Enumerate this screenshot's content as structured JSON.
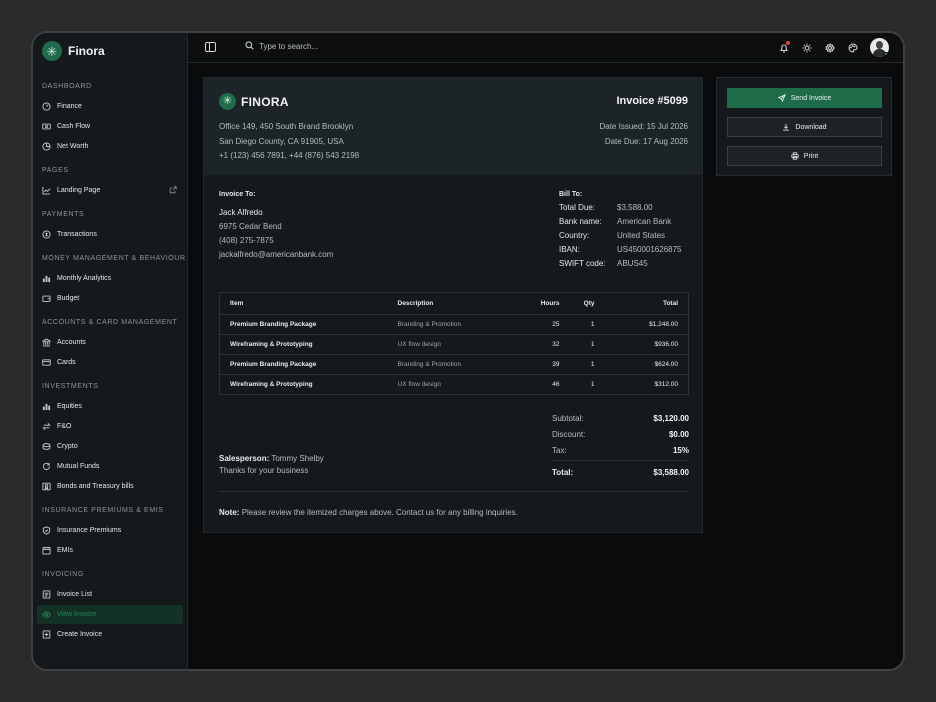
{
  "app": {
    "name": "Finora"
  },
  "sidebar": {
    "sections": [
      {
        "title": "DASHBOARD",
        "items": [
          {
            "label": "Finance",
            "icon": "gauge-icon"
          },
          {
            "label": "Cash Flow",
            "icon": "cash-icon"
          },
          {
            "label": "Net Worth",
            "icon": "pie-icon"
          }
        ]
      },
      {
        "title": "PAGES",
        "items": [
          {
            "label": "Landing Page",
            "icon": "chart-line-icon",
            "external": true
          }
        ]
      },
      {
        "title": "PAYMENTS",
        "items": [
          {
            "label": "Transactions",
            "icon": "coin-icon"
          }
        ]
      },
      {
        "title": "MONEY MANAGEMENT & BEHAVIOUR",
        "items": [
          {
            "label": "Monthly Analytics",
            "icon": "bar-chart-icon"
          },
          {
            "label": "Budget",
            "icon": "wallet-icon"
          }
        ]
      },
      {
        "title": "ACCOUNTS & CARD MANAGEMENT",
        "items": [
          {
            "label": "Accounts",
            "icon": "bank-icon"
          },
          {
            "label": "Cards",
            "icon": "card-icon"
          }
        ]
      },
      {
        "title": "INVESTMENTS",
        "items": [
          {
            "label": "Equities",
            "icon": "bar-chart-icon"
          },
          {
            "label": "F&O",
            "icon": "swap-icon"
          },
          {
            "label": "Crypto",
            "icon": "coins-icon"
          },
          {
            "label": "Mutual Funds",
            "icon": "refresh-icon"
          },
          {
            "label": "Bonds and Treasury bills",
            "icon": "certificate-icon"
          }
        ]
      },
      {
        "title": "INSURANCE PREMIUMS & EMIS",
        "items": [
          {
            "label": "Insurance Premiums",
            "icon": "shield-icon"
          },
          {
            "label": "EMIs",
            "icon": "calendar-icon"
          }
        ]
      },
      {
        "title": "INVOICING",
        "items": [
          {
            "label": "Invoice List",
            "icon": "list-icon"
          },
          {
            "label": "View Invoice",
            "icon": "eye-icon",
            "active": true
          },
          {
            "label": "Create Invoice",
            "icon": "plus-doc-icon"
          }
        ]
      }
    ]
  },
  "topbar": {
    "search_placeholder": "Type to search..."
  },
  "invoice": {
    "brand": "FINORA",
    "number": "Invoice #5099",
    "address": [
      "Office 149, 450 South Brand Brooklyn",
      "San Diego County, CA 91905, USA",
      "+1 (123) 456 7891, +44 (876) 543 2198"
    ],
    "date_issued": "Date Issued: 15 Jul 2026",
    "date_due": "Date Due: 17 Aug 2026",
    "invoice_to": {
      "label": "Invoice To:",
      "name": "Jack Alfredo",
      "lines": [
        "6975 Cedar Bend",
        "(408) 275-7875",
        "jackalfredo@americanbank.com"
      ]
    },
    "bill_to": {
      "label": "Bill To:",
      "rows": [
        {
          "k": "Total Due:",
          "v": "$3,588.00"
        },
        {
          "k": "Bank name:",
          "v": "American Bank"
        },
        {
          "k": "Country:",
          "v": "United States"
        },
        {
          "k": "IBAN:",
          "v": "US450001626875"
        },
        {
          "k": "SWIFT code:",
          "v": "ABUS45"
        }
      ]
    },
    "table": {
      "headers": [
        "Item",
        "Description",
        "Hours",
        "Qty",
        "Total"
      ],
      "rows": [
        [
          "Premium Branding Package",
          "Branding & Promotion",
          "25",
          "1",
          "$1,248.00"
        ],
        [
          "Wireframing & Prototyping",
          "UX flow design",
          "32",
          "1",
          "$936.00"
        ],
        [
          "Premium Branding Package",
          "Branding & Promotion",
          "39",
          "1",
          "$624.00"
        ],
        [
          "Wireframing & Prototyping",
          "UX flow design",
          "46",
          "1",
          "$312.00"
        ]
      ]
    },
    "salesperson_label": "Salesperson:",
    "salesperson": "Tommy Shelby",
    "thanks": "Thanks for your business",
    "summary": {
      "subtotal_label": "Subtotal:",
      "subtotal": "$3,120.00",
      "discount_label": "Discount:",
      "discount": "$0.00",
      "tax_label": "Tax:",
      "tax": "15%",
      "total_label": "Total:",
      "total": "$3,588.00"
    },
    "note_label": "Note:",
    "note": "Please review the itemized charges above. Contact us for any billing inquiries."
  },
  "actions": {
    "send": "Send Invoice",
    "download": "Download",
    "print": "Print"
  },
  "colors": {
    "accent": "#1e6b49",
    "active_text": "#1f8a59",
    "background": "#0a0b0c",
    "panel": "#15191b"
  }
}
